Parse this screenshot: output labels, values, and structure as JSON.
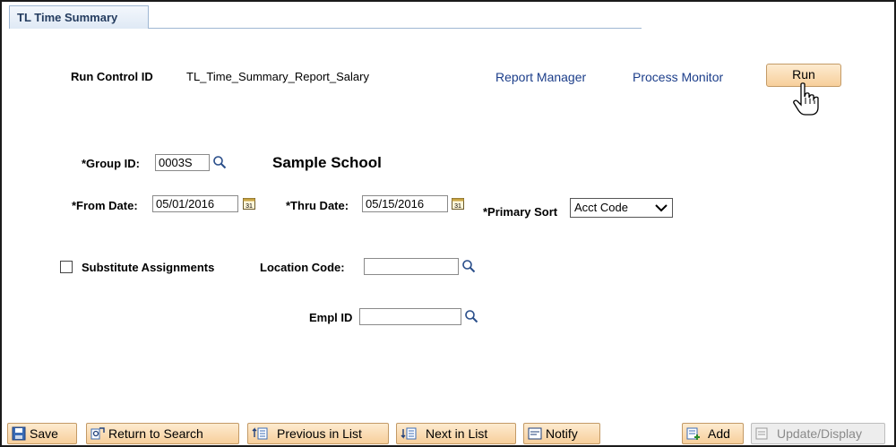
{
  "tab": {
    "label": "TL Time Summary"
  },
  "run_control": {
    "label": "Run Control ID",
    "value": "TL_Time_Summary_Report_Salary"
  },
  "links": {
    "report_manager": "Report Manager",
    "process_monitor": "Process Monitor"
  },
  "run_button": "Run",
  "group": {
    "label": "*Group ID:",
    "value": "0003S",
    "description": "Sample School"
  },
  "from_date": {
    "label": "*From Date:",
    "value": "05/01/2016"
  },
  "thru_date": {
    "label": "*Thru Date:",
    "value": "05/15/2016"
  },
  "primary_sort": {
    "label": "*Primary Sort",
    "value": "Acct Code"
  },
  "substitute": {
    "label": "Substitute Assignments",
    "checked": false
  },
  "location_code": {
    "label": "Location Code:",
    "value": ""
  },
  "empl_id": {
    "label": "Empl ID",
    "value": ""
  },
  "toolbar": {
    "save": "Save",
    "return_to_search": "Return to Search",
    "previous_in_list": "Previous in List",
    "next_in_list": "Next in List",
    "notify": "Notify",
    "add": "Add",
    "update_display": "Update/Display"
  },
  "colors": {
    "link": "#1c3e8a",
    "button_bg": "#f7cf9b",
    "tab_text": "#243c5f"
  }
}
